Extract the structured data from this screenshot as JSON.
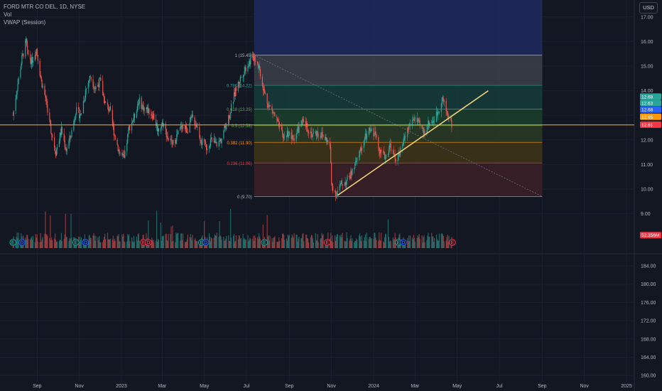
{
  "header": {
    "symbol_line": "FORD MTR CO DEL, 1D, NYSE",
    "indicator_1": "Vol",
    "indicator_2": "VWAP (Session)",
    "currency_button": "USD"
  },
  "chart_data": {
    "type": "candlestick",
    "symbol": "FORD MTR CO DEL",
    "interval": "1D",
    "exchange": "NYSE",
    "main_axis_ticks": [
      "17.00",
      "16.00",
      "15.00",
      "14.00",
      "13.00",
      "12.00",
      "11.00",
      "10.00",
      "9.00"
    ],
    "lower_axis_ticks": [
      "184.00",
      "180.00",
      "176.00",
      "172.00",
      "168.00",
      "164.00",
      "160.00"
    ],
    "x_axis_ticks": [
      "Sep",
      "Nov",
      "2023",
      "Mar",
      "May",
      "Jul",
      "Sep",
      "Nov",
      "2024",
      "Mar",
      "May",
      "Jul",
      "Sep",
      "Nov",
      "2025"
    ],
    "price_path": [
      [
        "2022-07-28",
        13.0
      ],
      [
        "2022-08-04",
        14.3
      ],
      [
        "2022-08-10",
        15.3
      ],
      [
        "2022-08-16",
        16.0
      ],
      [
        "2022-08-18",
        15.5
      ],
      [
        "2022-08-24",
        15.2
      ],
      [
        "2022-08-31",
        15.7
      ],
      [
        "2022-09-07",
        14.4
      ],
      [
        "2022-09-14",
        13.6
      ],
      [
        "2022-09-21",
        12.4
      ],
      [
        "2022-09-28",
        11.5
      ],
      [
        "2022-10-06",
        12.4
      ],
      [
        "2022-10-13",
        11.6
      ],
      [
        "2022-10-20",
        12.2
      ],
      [
        "2022-10-27",
        13.2
      ],
      [
        "2022-11-03",
        13.0
      ],
      [
        "2022-11-10",
        14.0
      ],
      [
        "2022-11-17",
        14.6
      ],
      [
        "2022-11-24",
        14.1
      ],
      [
        "2022-12-01",
        14.4
      ],
      [
        "2022-12-08",
        13.5
      ],
      [
        "2022-12-15",
        13.2
      ],
      [
        "2022-12-22",
        12.2
      ],
      [
        "2022-12-29",
        11.5
      ],
      [
        "2023-01-05",
        11.2
      ],
      [
        "2023-01-12",
        12.5
      ],
      [
        "2023-01-19",
        12.9
      ],
      [
        "2023-01-26",
        13.6
      ],
      [
        "2023-02-02",
        13.3
      ],
      [
        "2023-02-09",
        13.2
      ],
      [
        "2023-02-16",
        13.0
      ],
      [
        "2023-02-23",
        12.4
      ],
      [
        "2023-03-02",
        12.7
      ],
      [
        "2023-03-09",
        12.1
      ],
      [
        "2023-03-16",
        11.8
      ],
      [
        "2023-03-23",
        12.2
      ],
      [
        "2023-03-30",
        12.6
      ],
      [
        "2023-04-06",
        12.4
      ],
      [
        "2023-04-13",
        12.9
      ],
      [
        "2023-04-20",
        12.6
      ],
      [
        "2023-04-27",
        11.9
      ],
      [
        "2023-05-04",
        11.7
      ],
      [
        "2023-05-11",
        12.0
      ],
      [
        "2023-05-18",
        11.8
      ],
      [
        "2023-05-25",
        12.0
      ],
      [
        "2023-06-01",
        12.6
      ],
      [
        "2023-06-08",
        13.2
      ],
      [
        "2023-06-15",
        14.0
      ],
      [
        "2023-06-22",
        14.5
      ],
      [
        "2023-06-29",
        14.9
      ],
      [
        "2023-07-06",
        15.2
      ],
      [
        "2023-07-12",
        15.4
      ],
      [
        "2023-07-19",
        15.0
      ],
      [
        "2023-07-26",
        14.0
      ],
      [
        "2023-08-02",
        13.4
      ],
      [
        "2023-08-09",
        13.1
      ],
      [
        "2023-08-16",
        12.6
      ],
      [
        "2023-08-23",
        12.1
      ],
      [
        "2023-08-30",
        12.3
      ],
      [
        "2023-09-06",
        12.0
      ],
      [
        "2023-09-13",
        12.4
      ],
      [
        "2023-09-20",
        12.7
      ],
      [
        "2023-09-27",
        12.5
      ],
      [
        "2023-10-04",
        12.2
      ],
      [
        "2023-10-11",
        12.3
      ],
      [
        "2023-10-18",
        12.2
      ],
      [
        "2023-10-25",
        12.0
      ],
      [
        "2023-10-30",
        11.7
      ],
      [
        "2023-11-01",
        10.2
      ],
      [
        "2023-11-08",
        9.8
      ],
      [
        "2023-11-15",
        10.2
      ],
      [
        "2023-11-22",
        10.3
      ],
      [
        "2023-11-29",
        10.6
      ],
      [
        "2023-12-06",
        11.0
      ],
      [
        "2023-12-13",
        11.6
      ],
      [
        "2023-12-20",
        12.1
      ],
      [
        "2023-12-28",
        12.4
      ],
      [
        "2024-01-04",
        12.2
      ],
      [
        "2024-01-11",
        11.5
      ],
      [
        "2024-01-18",
        11.3
      ],
      [
        "2024-01-25",
        11.8
      ],
      [
        "2024-02-01",
        11.2
      ],
      [
        "2024-02-08",
        11.4
      ],
      [
        "2024-02-15",
        12.1
      ],
      [
        "2024-02-22",
        12.6
      ],
      [
        "2024-02-29",
        12.9
      ],
      [
        "2024-03-07",
        12.6
      ],
      [
        "2024-03-14",
        12.3
      ],
      [
        "2024-03-21",
        12.7
      ],
      [
        "2024-03-28",
        12.8
      ],
      [
        "2024-04-04",
        13.2
      ],
      [
        "2024-04-09",
        13.7
      ],
      [
        "2024-04-15",
        13.2
      ],
      [
        "2024-04-19",
        12.9
      ],
      [
        "2024-04-23",
        12.6
      ]
    ],
    "fibonacci": {
      "start_date": "2023-07-12",
      "end_date": "2023-11-10",
      "extends_to": "2024-09-01",
      "levels": [
        {
          "ratio": "1",
          "price": 15.45,
          "label": "1 (15.45)",
          "label_color": "#b2b5be",
          "fill": "#3a3d47"
        },
        {
          "ratio": "0.786",
          "price": 14.22,
          "label": "0.786 (14.22)",
          "label_color": "#26a69a",
          "fill": "#163a3a"
        },
        {
          "ratio": "0.618",
          "price": 13.25,
          "label": "0.618 (13.25)",
          "label_color": "#4caf50",
          "fill": "#1b3d2c"
        },
        {
          "ratio": "0.5",
          "price": 12.58,
          "label": "0.5 (12.58)",
          "label_color": "#4caf50",
          "fill": "#2a3a25"
        },
        {
          "ratio": "0.382",
          "price": 11.9,
          "label": "0.382 (11.90)",
          "label_color": "#ff9800",
          "fill": "#3d3318"
        },
        {
          "ratio": "0.236",
          "price": 11.06,
          "label": "0.236 (11.06)",
          "label_color": "#f23645",
          "fill": "#3a1f26"
        },
        {
          "ratio": "0",
          "price": 9.7,
          "label": "0 (9.70)",
          "label_color": "#b2b5be",
          "fill": null
        }
      ],
      "top_fill": "#1e2a5e",
      "diagonal_color": "#787b86"
    },
    "trendline": {
      "start_date": "2023-11-10",
      "start_price": 9.75,
      "end_date": "2024-06-15",
      "end_price": 14.0,
      "color": "#f0d27a"
    },
    "horizontal_line": {
      "price": 12.61,
      "color": "#ff9800"
    },
    "price_labels": [
      {
        "text": "12.68",
        "price": 13.76,
        "color": "#26a69a"
      },
      {
        "text": "12.63",
        "price": 13.5,
        "color": "#26a69a"
      },
      {
        "text": "12.68",
        "price": 13.23,
        "color": "#2962ff"
      },
      {
        "text": "12.65",
        "price": 12.94,
        "color": "#ff9800"
      },
      {
        "text": "12.61",
        "price": 12.62,
        "color": "#f23645"
      },
      {
        "text": "52.356M",
        "price": 8.13,
        "color": "#f23645"
      }
    ],
    "volume_label": "52.356M",
    "earnings_events": [
      {
        "date": "2022-07-28",
        "letter": "E",
        "color": "#26a69a"
      },
      {
        "date": "2022-08-10",
        "letter": "D",
        "color": "#2962ff"
      },
      {
        "date": "2022-10-27",
        "letter": "E",
        "color": "#26a69a"
      },
      {
        "date": "2022-11-10",
        "letter": "D",
        "color": "#2962ff"
      },
      {
        "date": "2023-02-02",
        "letter": "E",
        "color": "#f23645"
      },
      {
        "date": "2023-02-09",
        "letter": "D",
        "color": "#f23645"
      },
      {
        "date": "2023-04-27",
        "letter": "E",
        "color": "#26a69a"
      },
      {
        "date": "2023-05-03",
        "letter": "D",
        "color": "#2962ff"
      },
      {
        "date": "2023-07-27",
        "letter": "E",
        "color": "#26a69a"
      },
      {
        "date": "2023-10-26",
        "letter": "E",
        "color": "#f23645"
      },
      {
        "date": "2024-02-06",
        "letter": "E",
        "color": "#26a69a"
      },
      {
        "date": "2024-02-13",
        "letter": "D",
        "color": "#2962ff"
      },
      {
        "date": "2024-04-24",
        "letter": "E",
        "color": "#f23645"
      }
    ]
  }
}
